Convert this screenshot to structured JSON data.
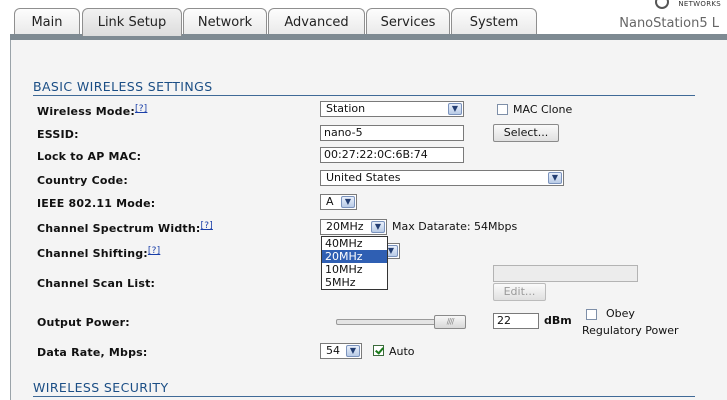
{
  "header": {
    "tabs": [
      {
        "label": "Main"
      },
      {
        "label": "Link Setup"
      },
      {
        "label": "Network"
      },
      {
        "label": "Advanced"
      },
      {
        "label": "Services"
      },
      {
        "label": "System"
      }
    ],
    "device_name": "NanoStation5 L",
    "brand_text": "NETWORKS"
  },
  "sections": {
    "basic": "BASIC WIRELESS SETTINGS",
    "security": "WIRELESS SECURITY"
  },
  "help_link": "[?]",
  "fields": {
    "wireless_mode": {
      "label": "Wireless Mode:",
      "value": "Station"
    },
    "mac_clone": {
      "label": "MAC Clone"
    },
    "essid": {
      "label": "ESSID:",
      "value": "nano-5",
      "select_button": "Select..."
    },
    "lock_ap_mac": {
      "label": "Lock to AP MAC:",
      "value": "00:27:22:0C:6B:74"
    },
    "country_code": {
      "label": "Country Code:",
      "value": "United States"
    },
    "ieee_mode": {
      "label": "IEEE 802.11 Mode:",
      "value": "A"
    },
    "channel_width": {
      "label": "Channel Spectrum Width:",
      "value": "20MHz",
      "max_datarate": "Max Datarate: 54Mbps",
      "options": [
        "40MHz",
        "20MHz",
        "10MHz",
        "5MHz"
      ],
      "selected_index": 1
    },
    "channel_shifting": {
      "label": "Channel Shifting:"
    },
    "channel_scan_list": {
      "label": "Channel Scan List:",
      "value": "",
      "edit_button": "Edit..."
    },
    "output_power": {
      "label": "Output Power:",
      "value": "22",
      "unit": "dBm",
      "obey_label_1": "Obey",
      "obey_label_2": "Regulatory Power"
    },
    "data_rate": {
      "label": "Data Rate, Mbps:",
      "value": "54",
      "auto_label": "Auto"
    }
  },
  "colors": {
    "section_heading": "#1b4e85",
    "help_link": "#1a3fa8",
    "dropdown_highlight": "#2f5fb3"
  }
}
